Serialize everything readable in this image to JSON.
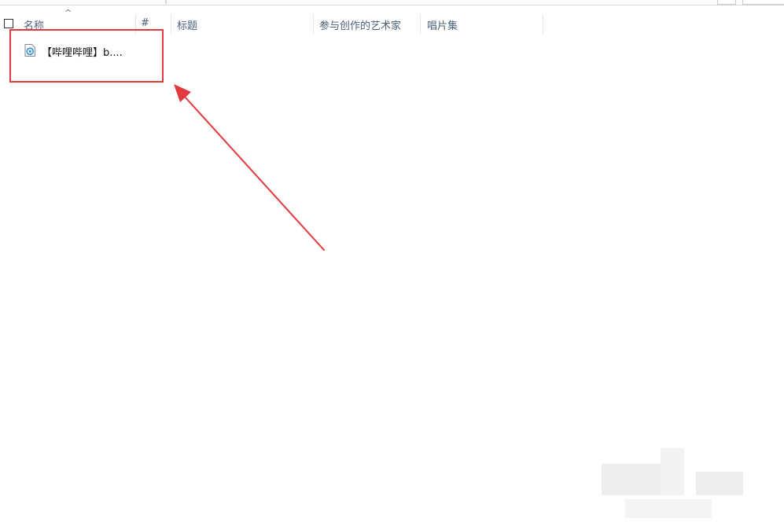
{
  "colors": {
    "header_text": "#4c607a",
    "annotation": "#e0393e",
    "file_icon": "#2f8fd3"
  },
  "columns": {
    "name": "名称",
    "number": "#",
    "title": "标题",
    "artist": "参与创作的艺术家",
    "album": "唱片集"
  },
  "sort_indicator": "^",
  "files": [
    {
      "name": "【哔哩哔哩】b....",
      "icon": "media-file-icon"
    }
  ]
}
